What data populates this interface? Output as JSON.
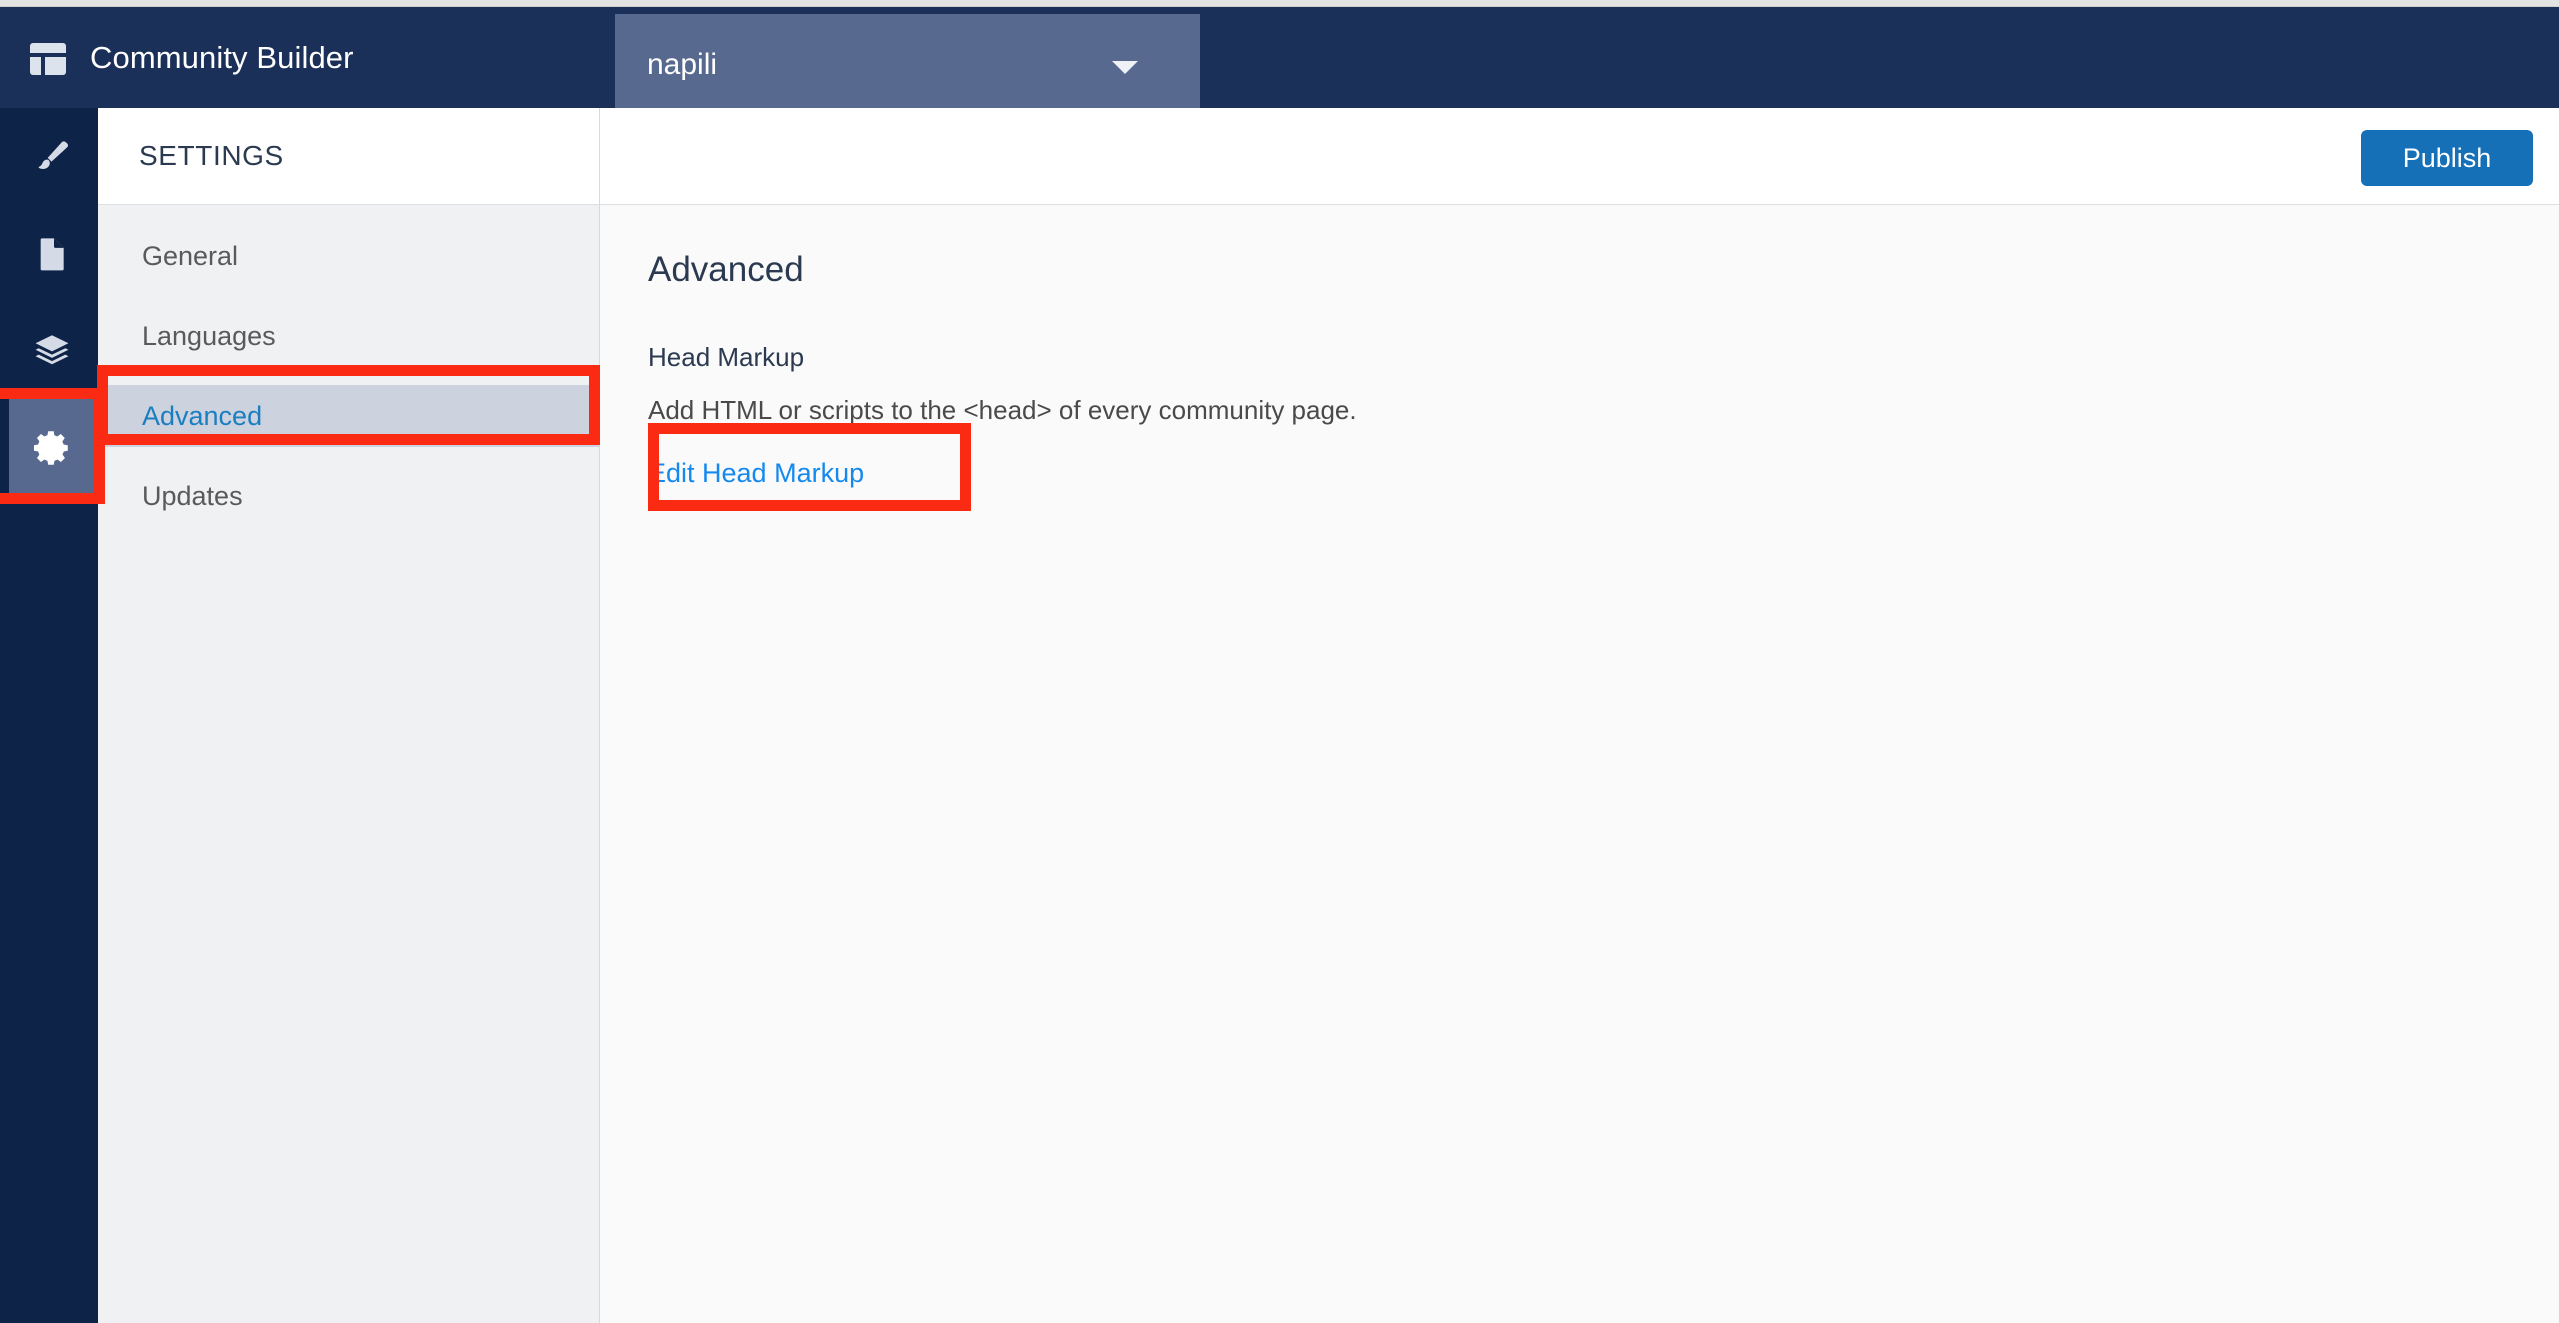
{
  "app": {
    "title": "Community Builder",
    "logo_icon": "layout-template-icon"
  },
  "site_picker": {
    "selected": "napili",
    "caret_icon": "chevron-down-icon"
  },
  "icon_rail": {
    "items": [
      {
        "name": "theme",
        "icon": "paintbrush-icon",
        "active": false
      },
      {
        "name": "pages",
        "icon": "page-icon",
        "active": false
      },
      {
        "name": "components",
        "icon": "layers-icon",
        "active": false
      },
      {
        "name": "settings",
        "icon": "gear-icon",
        "active": true
      }
    ]
  },
  "settings": {
    "header": "SETTINGS",
    "nav": [
      {
        "label": "General",
        "selected": false
      },
      {
        "label": "Languages",
        "selected": false
      },
      {
        "label": "Advanced",
        "selected": true
      },
      {
        "label": "Updates",
        "selected": false
      }
    ]
  },
  "toolbar": {
    "publish_label": "Publish"
  },
  "main": {
    "page_title": "Advanced",
    "section": {
      "label": "Head Markup",
      "help_text": "Add HTML or scripts to the <head> of every community page.",
      "edit_link_label": "Edit Head Markup"
    }
  },
  "annotations": {
    "color": "#fb2a12",
    "boxes": [
      {
        "target": "settings-gear-rail-button"
      },
      {
        "target": "settings-nav-item-advanced"
      },
      {
        "target": "edit-head-markup-link"
      }
    ]
  },
  "colors": {
    "header_navy": "#1b3059",
    "rail_navy": "#0e2348",
    "picker_blue": "#58698f",
    "publish_blue": "#1670b8",
    "link_blue": "#1589ee",
    "selected_nav_bg": "#ccd2de",
    "selected_nav_text": "#1b7ec1",
    "panel_gray": "#f0f1f3",
    "annotation_red": "#fb2a12"
  }
}
